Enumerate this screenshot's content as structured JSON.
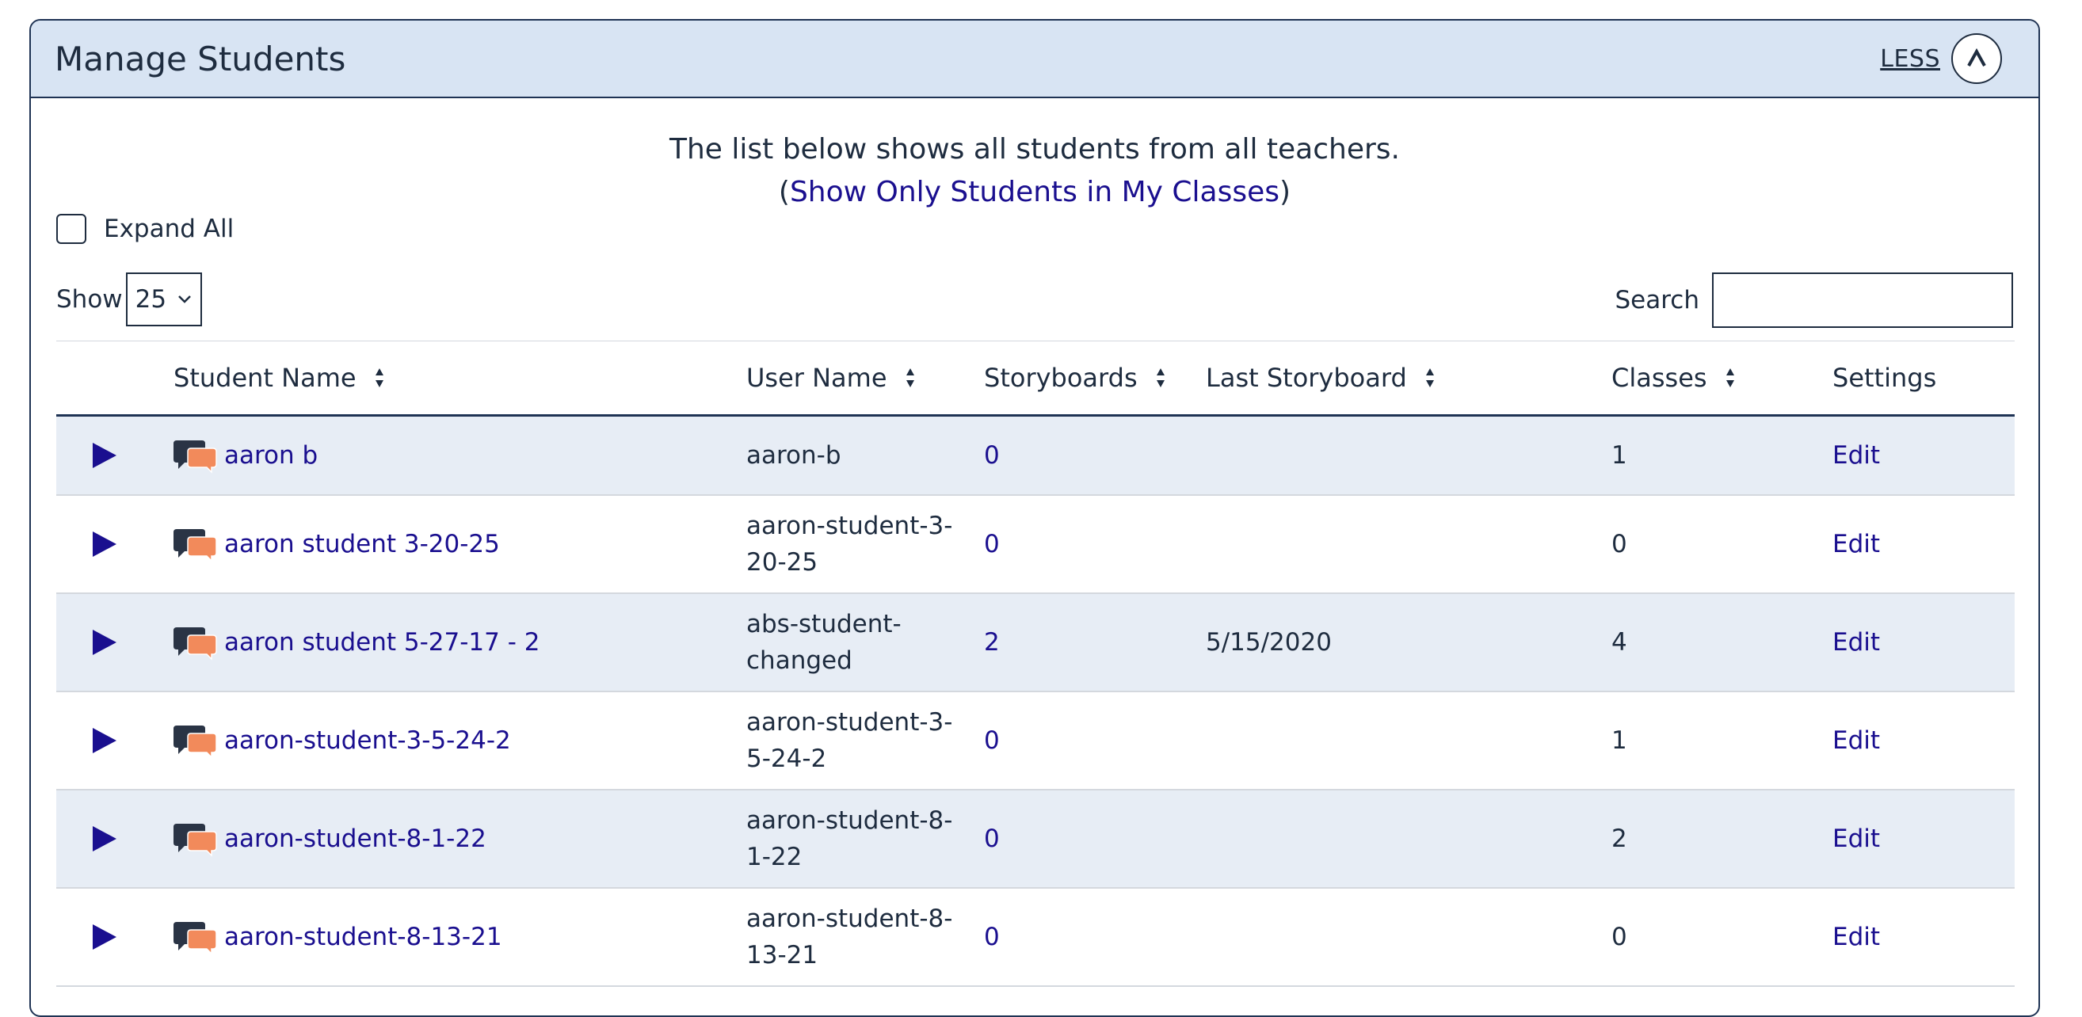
{
  "panel": {
    "title": "Manage Students",
    "less_label": "LESS"
  },
  "intro": {
    "line1": "The list below shows all students from all teachers.",
    "link_open": "(",
    "link_text": "Show Only Students in My Classes",
    "link_close": ")"
  },
  "expand_all_label": "Expand All",
  "show": {
    "label": "Show",
    "value": "25"
  },
  "search": {
    "label": "Search",
    "value": ""
  },
  "table": {
    "headers": {
      "student_name": "Student Name",
      "user_name": "User Name",
      "storyboards": "Storyboards",
      "last_storyboard": "Last Storyboard",
      "classes": "Classes",
      "settings": "Settings"
    },
    "rows": [
      {
        "student_name": "aaron b",
        "user_name_1": "aaron-b",
        "user_name_2": "",
        "storyboards": "0",
        "last_storyboard": "",
        "classes": "1",
        "settings": "Edit"
      },
      {
        "student_name": "aaron student 3-20-25",
        "user_name_1": "aaron-student-3-",
        "user_name_2": "20-25",
        "storyboards": "0",
        "last_storyboard": "",
        "classes": "0",
        "settings": "Edit"
      },
      {
        "student_name": "aaron student 5-27-17 - 2",
        "user_name_1": "abs-student-",
        "user_name_2": "changed",
        "storyboards": "2",
        "last_storyboard": "5/15/2020",
        "classes": "4",
        "settings": "Edit"
      },
      {
        "student_name": "aaron-student-3-5-24-2",
        "user_name_1": "aaron-student-3-",
        "user_name_2": "5-24-2",
        "storyboards": "0",
        "last_storyboard": "",
        "classes": "1",
        "settings": "Edit"
      },
      {
        "student_name": "aaron-student-8-1-22",
        "user_name_1": "aaron-student-8-",
        "user_name_2": "1-22",
        "storyboards": "0",
        "last_storyboard": "",
        "classes": "2",
        "settings": "Edit"
      },
      {
        "student_name": "aaron-student-8-13-21",
        "user_name_1": "aaron-student-8-",
        "user_name_2": "13-21",
        "storyboards": "0",
        "last_storyboard": "",
        "classes": "0",
        "settings": "Edit"
      }
    ]
  },
  "colors": {
    "header_bg": "#d8e4f3",
    "row_shade": "#e7edf5",
    "link": "#1a0f8f",
    "border": "#1f3354",
    "chat_dark": "#2a3445",
    "chat_orange": "#f28a5b"
  }
}
